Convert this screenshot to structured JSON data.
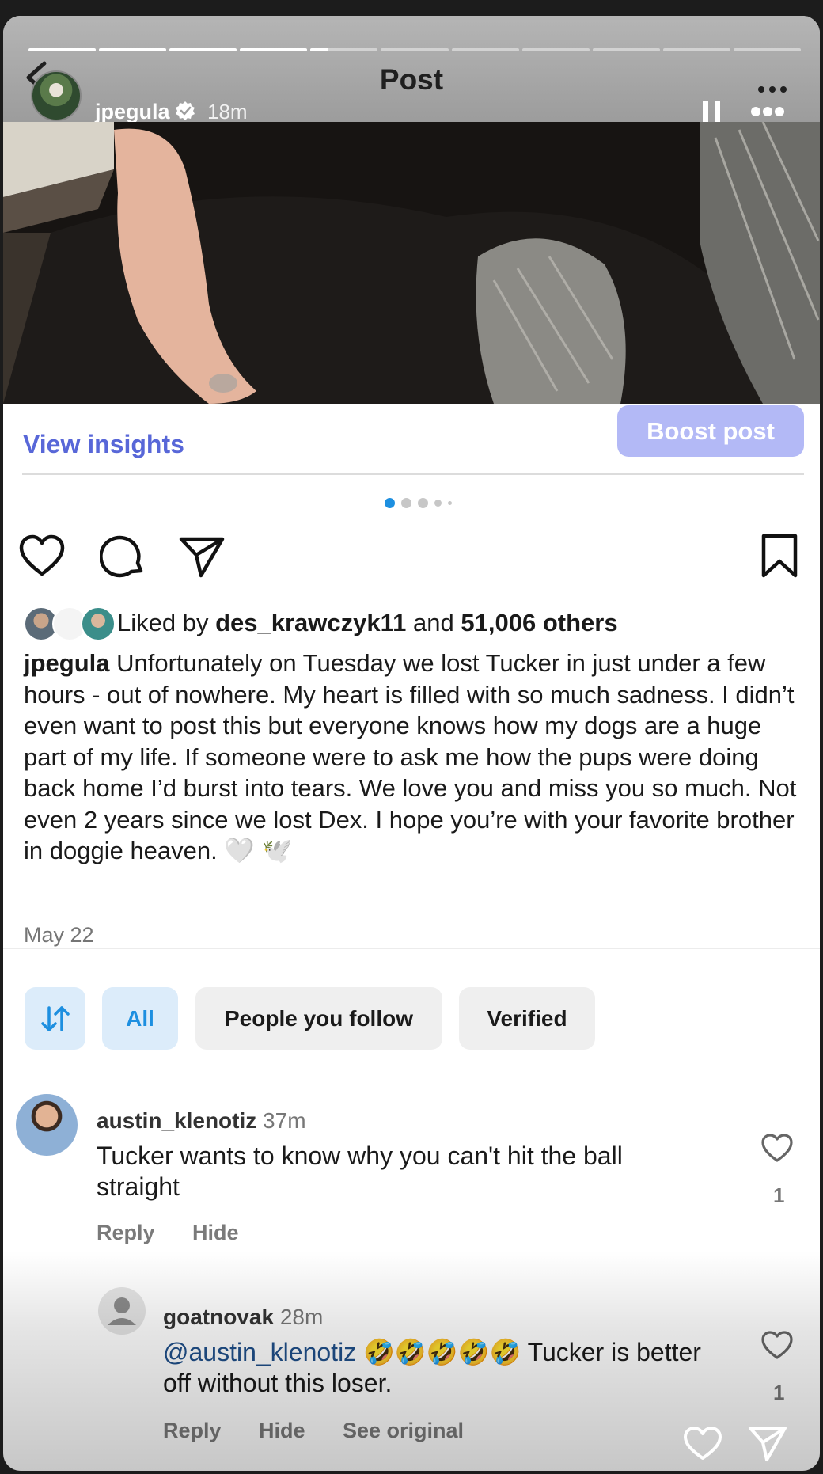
{
  "story": {
    "title": "Post",
    "username": "jpegula",
    "time": "18m",
    "progress_segments": [
      1,
      1,
      1,
      1,
      0.25,
      0,
      0,
      0,
      0,
      0,
      0
    ]
  },
  "insights": {
    "view_label": "View insights",
    "boost_label": "Boost post"
  },
  "likes": {
    "prefix": "Liked by",
    "user": "des_krawczyk11",
    "joiner": "and",
    "others": "51,006 others"
  },
  "caption": {
    "username": "jpegula",
    "text": "Unfortunately on Tuesday we lost Tucker in just under a few hours - out of nowhere. My heart is filled with so much sadness. I didn’t even want to post this but everyone knows how my dogs are a huge part of my life. If someone were to ask me how the pups were doing back home I’d burst into tears. We love you and miss you so much. Not even 2 years since we lost Dex. I hope you’re with your favorite brother in doggie heaven. 🤍 🕊️"
  },
  "post_date": "May 22",
  "filters": {
    "all": "All",
    "people_you_follow": "People you follow",
    "verified": "Verified"
  },
  "comments": [
    {
      "username": "austin_klenotiz",
      "time": "37m",
      "text": "Tucker wants to know why you can't hit the ball straight",
      "likes": "1",
      "reply": "Reply",
      "hide": "Hide"
    },
    {
      "username": "goatnovak",
      "time": "28m",
      "mention": "@austin_klenotiz",
      "text": "🤣🤣🤣🤣🤣 Tucker is better off without this loser.",
      "likes": "1",
      "reply": "Reply",
      "hide": "Hide",
      "see_original": "See original"
    }
  ],
  "colors": {
    "accent_link": "#5867d8",
    "boost_button": "#b3b9f6",
    "chip_blue_bg": "#dcecfa",
    "chip_blue_text": "#1d8fe0",
    "mention": "#1f4f8a"
  },
  "icons": [
    "back-chevron-icon",
    "verified-icon",
    "pause-icon",
    "more-icon",
    "heart-icon",
    "comment-icon",
    "share-icon",
    "bookmark-icon",
    "sort-icon"
  ]
}
